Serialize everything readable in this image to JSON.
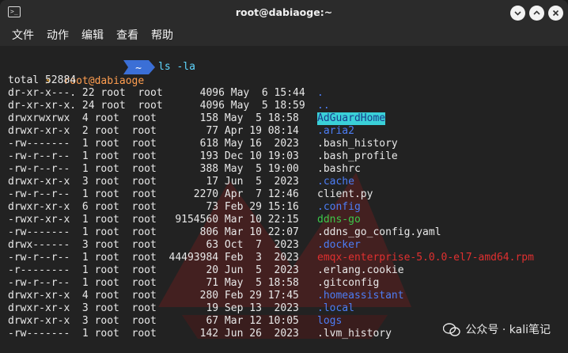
{
  "window": {
    "title": "root@dabiaoge:~"
  },
  "menu": [
    "文件",
    "动作",
    "编辑",
    "查看",
    "帮助"
  ],
  "prompt": {
    "bolt": "⚡",
    "user": "root@dabiaoge",
    "dir": "~",
    "command": "ls -la"
  },
  "listing": {
    "total": "total 52884",
    "rows": [
      {
        "meta": "dr-xr-x---. 22 root  root      4096 May  6 15:44",
        "name": ".",
        "kind": "dir"
      },
      {
        "meta": "dr-xr-xr-x. 24 root  root      4096 May  5 18:59",
        "name": "..",
        "kind": "dir"
      },
      {
        "meta": "drwxrwxrwx  4 root  root       158 May  5 18:58",
        "name": "AdGuardHome",
        "kind": "hl"
      },
      {
        "meta": "drwxr-xr-x  2 root  root        77 Apr 19 08:14",
        "name": ".aria2",
        "kind": "dir"
      },
      {
        "meta": "-rw-------  1 root  root       618 May 16  2023",
        "name": ".bash_history",
        "kind": "file"
      },
      {
        "meta": "-rw-r--r--  1 root  root       193 Dec 10 19:03",
        "name": ".bash_profile",
        "kind": "file"
      },
      {
        "meta": "-rw-r--r--  1 root  root       388 May  5 19:00",
        "name": ".bashrc",
        "kind": "file"
      },
      {
        "meta": "drwxr-xr-x  3 root  root        17 Jun  5  2023",
        "name": ".cache",
        "kind": "dir"
      },
      {
        "meta": "-rw-r--r--  1 root  root      2270 Apr  7 12:46",
        "name": "client.py",
        "kind": "file"
      },
      {
        "meta": "drwxr-xr-x  6 root  root        73 Feb 29 15:16",
        "name": ".config",
        "kind": "dir"
      },
      {
        "meta": "-rwxr-xr-x  1 root  root   9154560 Mar 10 22:15",
        "name": "ddns-go",
        "kind": "exec"
      },
      {
        "meta": "-rw-------  1 root  root       806 Mar 10 22:07",
        "name": ".ddns_go_config.yaml",
        "kind": "file"
      },
      {
        "meta": "drwx------  3 root  root        63 Oct  7  2023",
        "name": ".docker",
        "kind": "dir"
      },
      {
        "meta": "-rw-r--r--  1 root  root  44493984 Feb  3  2023",
        "name": "emqx-enterprise-5.0.0-el7-amd64.rpm",
        "kind": "red"
      },
      {
        "meta": "-r--------  1 root  root        20 Jun  5  2023",
        "name": ".erlang.cookie",
        "kind": "file"
      },
      {
        "meta": "-rw-r--r--  1 root  root        71 May  5 18:58",
        "name": ".gitconfig",
        "kind": "file"
      },
      {
        "meta": "drwxr-xr-x  4 root  root       280 Feb 29 17:45",
        "name": ".homeassistant",
        "kind": "dir"
      },
      {
        "meta": "drwxr-xr-x  3 root  root        19 Sep 13  2023",
        "name": ".local",
        "kind": "dir"
      },
      {
        "meta": "drwxr-xr-x  3 root  root        67 Mar 12 10:05",
        "name": "logs",
        "kind": "dir"
      },
      {
        "meta": "-rw-------  1 root  root       142 Jun 26  2023",
        "name": ".lvm_history",
        "kind": "file"
      }
    ]
  },
  "watermark": {
    "text": "公众号 · kali笔记"
  },
  "colors": {
    "dir": "#4c7df5",
    "exec": "#3cc84a",
    "archive": "#e03030",
    "highlight_bg": "#3ad0d8",
    "prompt_seg": "#3b6fd6"
  }
}
